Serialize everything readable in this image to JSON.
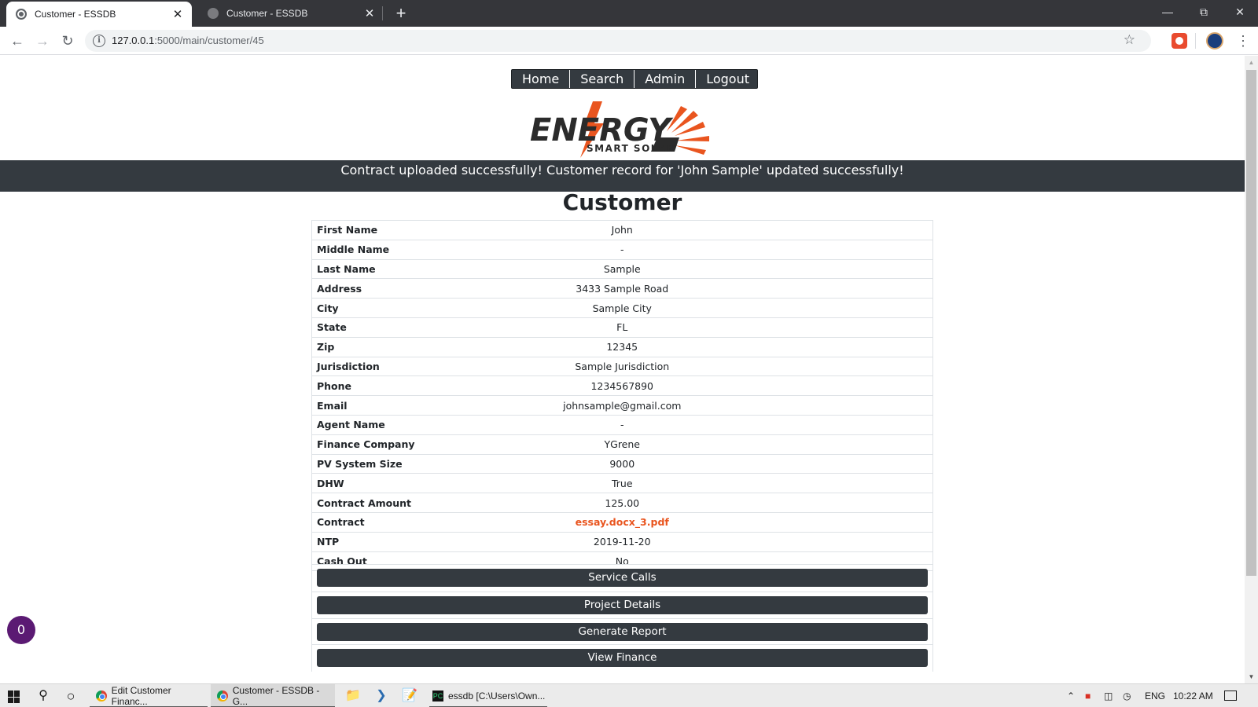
{
  "browser": {
    "tabs": [
      {
        "title": "Customer - ESSDB",
        "active": true
      },
      {
        "title": "Customer - ESSDB",
        "active": false
      }
    ],
    "new_tab": "+",
    "url_host": "127.0.0.1",
    "url_path": ":5000/main/customer/45"
  },
  "nav": {
    "items": [
      "Home",
      "Search",
      "Admin",
      "Logout"
    ]
  },
  "logo": {
    "line1": "ENERGY",
    "line2": "SMART SOLAR"
  },
  "flash_message": "Contract uploaded successfully! Customer record for 'John Sample' updated successfully!",
  "page_title": "Customer",
  "customer": {
    "rows": [
      {
        "label": "First Name",
        "value": "John"
      },
      {
        "label": "Middle Name",
        "value": "-"
      },
      {
        "label": "Last Name",
        "value": "Sample"
      },
      {
        "label": "Address",
        "value": "3433 Sample Road"
      },
      {
        "label": "City",
        "value": "Sample City"
      },
      {
        "label": "State",
        "value": "FL"
      },
      {
        "label": "Zip",
        "value": "12345"
      },
      {
        "label": "Jurisdiction",
        "value": "Sample Jurisdiction"
      },
      {
        "label": "Phone",
        "value": "1234567890"
      },
      {
        "label": "Email",
        "value": "johnsample@gmail.com"
      },
      {
        "label": "Agent Name",
        "value": "-"
      },
      {
        "label": "Finance Company",
        "value": "YGrene"
      },
      {
        "label": "PV System Size",
        "value": "9000"
      },
      {
        "label": "DHW",
        "value": "True"
      },
      {
        "label": "Contract Amount",
        "value": "125.00"
      },
      {
        "label": "Contract",
        "value": "essay.docx_3.pdf",
        "link": true
      },
      {
        "label": "NTP",
        "value": "2019-11-20"
      },
      {
        "label": "Cash Out",
        "value": "No"
      }
    ]
  },
  "actions": [
    "Service Calls",
    "Project Details",
    "Generate Report",
    "View Finance"
  ],
  "fab_count": "0",
  "taskbar": {
    "items": [
      {
        "label": "Edit Customer Financ..."
      },
      {
        "label": "Customer - ESSDB - G..."
      },
      {
        "label": "essdb [C:\\Users\\Own..."
      }
    ],
    "language": "ENG",
    "time": "10:22 AM"
  }
}
